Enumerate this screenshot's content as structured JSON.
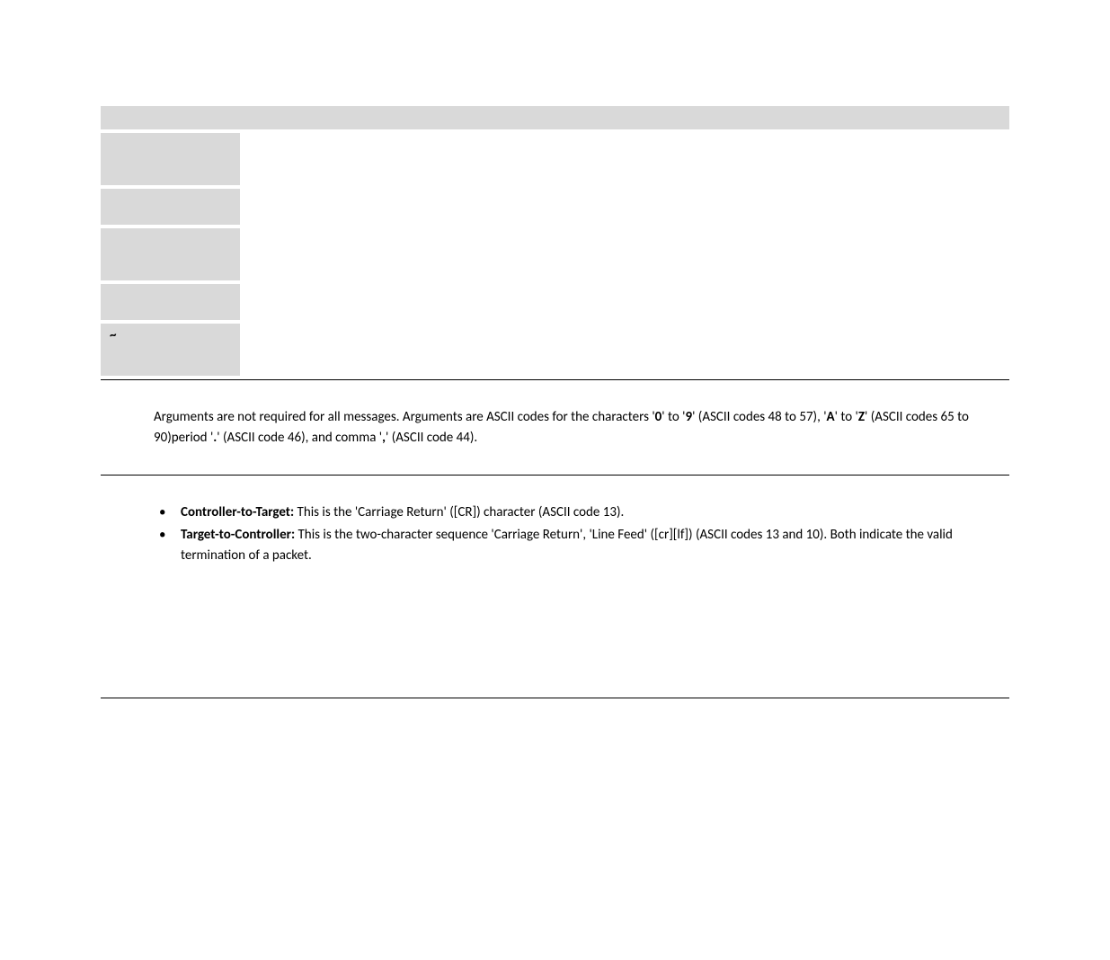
{
  "table": {
    "tilde": "~"
  },
  "paragraph1": {
    "text_a": "Arguments are not required for all messages. Arguments are ASCII codes for the characters '",
    "b1": "0",
    "text_b": "' to '",
    "b2": "9",
    "text_c": "' (ASCII codes 48 to 57), '",
    "b3": "A",
    "text_d": "' to '",
    "b4": "Z",
    "text_e": "' (ASCII codes 65 to 90)period '",
    "b5": ".",
    "text_f": "' (ASCII code 46), and comma '",
    "b6": ",",
    "text_g": "' (ASCII code 44)."
  },
  "bullets": {
    "item1": {
      "label": "Controller-to-Target:",
      "text": " This is the 'Carriage Return' ([CR]) character (ASCII code 13)."
    },
    "item2": {
      "label": "Target-to-Controller:",
      "text": " This is the two-character sequence 'Carriage Return', 'Line Feed' ([cr][lf]) (ASCII codes 13 and 10). Both indicate the valid termination of a packet."
    }
  }
}
